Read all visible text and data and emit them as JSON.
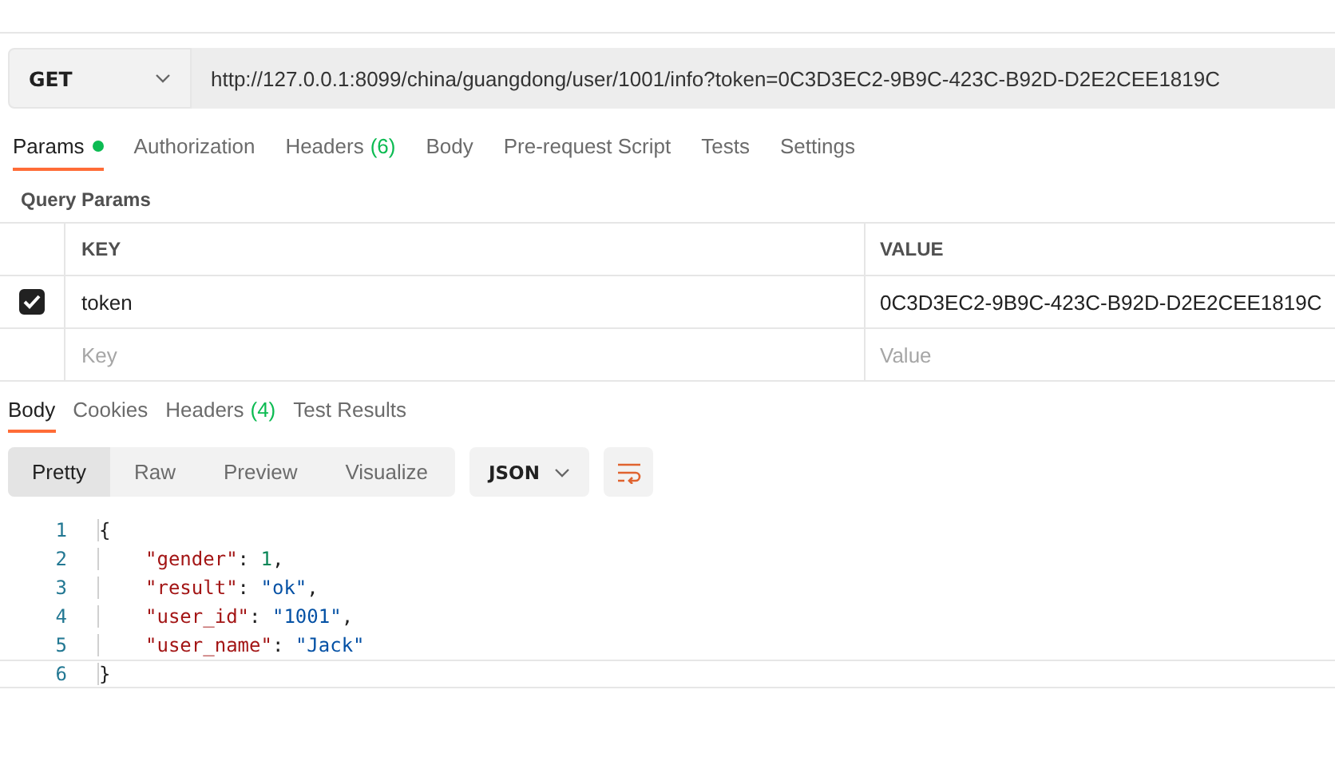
{
  "request": {
    "method": "GET",
    "url": "http://127.0.0.1:8099/china/guangdong/user/1001/info?token=0C3D3EC2-9B9C-423C-B92D-D2E2CEE1819C"
  },
  "request_tabs": [
    {
      "label": "Params",
      "dot": true,
      "selected": true
    },
    {
      "label": "Authorization",
      "dot": false,
      "selected": false
    },
    {
      "label": "Headers",
      "count": "(6)",
      "dot": false,
      "selected": false
    },
    {
      "label": "Body",
      "dot": false,
      "selected": false
    },
    {
      "label": "Pre-request Script",
      "dot": false,
      "selected": false
    },
    {
      "label": "Tests",
      "dot": false,
      "selected": false
    },
    {
      "label": "Settings",
      "dot": false,
      "selected": false
    }
  ],
  "query_params": {
    "title": "Query Params",
    "columns": [
      "KEY",
      "VALUE"
    ],
    "rows": [
      {
        "key": "token",
        "value": "0C3D3EC2-9B9C-423C-B92D-D2E2CEE1819C",
        "checked": true
      }
    ],
    "new_row": {
      "key_placeholder": "Key",
      "value_placeholder": "Value"
    }
  },
  "response_tabs": [
    {
      "label": "Body",
      "selected": true
    },
    {
      "label": "Cookies",
      "selected": false
    },
    {
      "label": "Headers",
      "count": "(4)",
      "selected": false
    },
    {
      "label": "Test Results",
      "selected": false
    }
  ],
  "view_modes": [
    {
      "label": "Pretty",
      "selected": true
    },
    {
      "label": "Raw",
      "selected": false
    },
    {
      "label": "Preview",
      "selected": false
    },
    {
      "label": "Visualize",
      "selected": false
    }
  ],
  "format": "JSON",
  "code_lines": [
    {
      "number": "1",
      "current": false,
      "tokens": [
        {
          "kind": "bracket",
          "text": "{"
        }
      ]
    },
    {
      "number": "2",
      "current": false,
      "tokens": [
        {
          "kind": "key",
          "text": "\"gender\""
        },
        {
          "kind": "punct",
          "text": ": "
        },
        {
          "kind": "number",
          "text": "1"
        },
        {
          "kind": "punct",
          "text": ","
        }
      ]
    },
    {
      "number": "3",
      "current": false,
      "tokens": [
        {
          "kind": "key",
          "text": "\"result\""
        },
        {
          "kind": "punct",
          "text": ": "
        },
        {
          "kind": "string",
          "text": "\"ok\""
        },
        {
          "kind": "punct",
          "text": ","
        }
      ]
    },
    {
      "number": "4",
      "current": false,
      "tokens": [
        {
          "kind": "key",
          "text": "\"user_id\""
        },
        {
          "kind": "punct",
          "text": ": "
        },
        {
          "kind": "string",
          "text": "\"1001\""
        },
        {
          "kind": "punct",
          "text": ","
        }
      ]
    },
    {
      "number": "5",
      "current": false,
      "tokens": [
        {
          "kind": "key",
          "text": "\"user_name\""
        },
        {
          "kind": "punct",
          "text": ": "
        },
        {
          "kind": "string",
          "text": "\"Jack\""
        }
      ]
    },
    {
      "number": "6",
      "current": true,
      "tokens": [
        {
          "kind": "bracket",
          "text": "}"
        }
      ]
    }
  ]
}
